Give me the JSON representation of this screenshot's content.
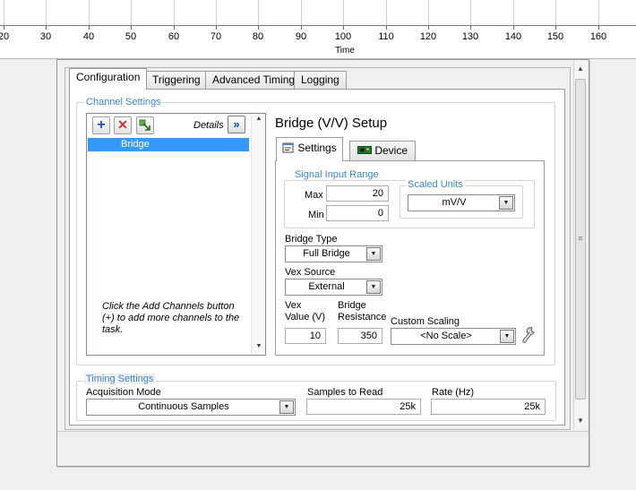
{
  "graph": {
    "ticks": [
      "20",
      "30",
      "40",
      "50",
      "60",
      "70",
      "80",
      "90",
      "100",
      "110",
      "120",
      "130",
      "140",
      "150",
      "160"
    ],
    "axis_title": "Time"
  },
  "tabs": [
    {
      "label": "Configuration",
      "active": true
    },
    {
      "label": "Triggering",
      "active": false
    },
    {
      "label": "Advanced Timing",
      "active": false
    },
    {
      "label": "Logging",
      "active": false
    }
  ],
  "channel_settings": {
    "title": "Channel Settings",
    "details_label": "Details",
    "details_button": "»",
    "channels": [
      "Bridge"
    ],
    "hint": "Click the Add Channels button (+) to add more channels to the task."
  },
  "setup": {
    "title": "Bridge (V/V) Setup",
    "subtabs": [
      {
        "label": "Settings",
        "active": true
      },
      {
        "label": "Device",
        "active": false
      }
    ],
    "signal_input_range": {
      "title": "Signal Input Range",
      "max_label": "Max",
      "max": "20",
      "min_label": "Min",
      "min": "0"
    },
    "scaled_units": {
      "title": "Scaled Units",
      "value": "mV/V"
    },
    "bridge_type": {
      "label": "Bridge Type",
      "value": "Full Bridge"
    },
    "vex_source": {
      "label": "Vex Source",
      "value": "External"
    },
    "vex_value": {
      "label_line1": "Vex",
      "label_line2": "Value (V)",
      "value": "10"
    },
    "bridge_resistance": {
      "label_line1": "Bridge",
      "label_line2": "Resistance",
      "value": "350"
    },
    "custom_scaling": {
      "label": "Custom Scaling",
      "value": "<No Scale>"
    }
  },
  "timing": {
    "title": "Timing Settings",
    "acquisition_mode": {
      "label": "Acquisition Mode",
      "value": "Continuous Samples"
    },
    "samples_to_read": {
      "label": "Samples to Read",
      "value": "25k"
    },
    "rate": {
      "label": "Rate (Hz)",
      "value": "25k"
    }
  },
  "colors": {
    "group_label": "#3d87c4",
    "selection": "#3399ff",
    "delete_red": "#d03030",
    "add_blue": "#1f4fbf"
  }
}
